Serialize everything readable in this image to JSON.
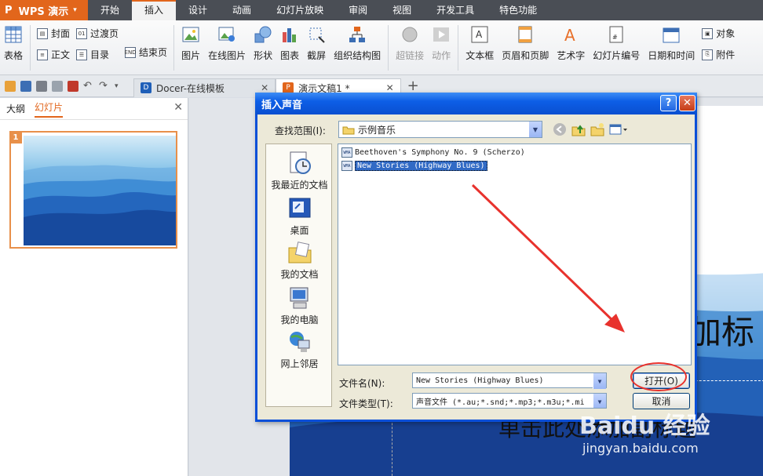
{
  "app": {
    "logo": "WPS 演示"
  },
  "menu": [
    "开始",
    "插入",
    "设计",
    "动画",
    "幻灯片放映",
    "审阅",
    "视图",
    "开发工具",
    "特色功能"
  ],
  "ribbon": {
    "table": "表格",
    "cover": "封面",
    "transition_page": "过渡页",
    "body": "正文",
    "toc": "目录",
    "end_page": "结束页",
    "picture": "图片",
    "online_picture": "在线图片",
    "shape": "形状",
    "chart": "图表",
    "screenshot": "截屏",
    "org_chart": "组织结构图",
    "hyperlink": "超链接",
    "action": "动作",
    "textbox": "文本框",
    "header_footer": "页眉和页脚",
    "wordart": "艺术字",
    "slide_number": "幻灯片编号",
    "datetime": "日期和时间",
    "object": "对象",
    "attachment": "附件"
  },
  "tabs": {
    "docer": "Docer-在线模板",
    "doc1": "演示文稿1 *"
  },
  "left_panel": {
    "outline": "大纲",
    "slides": "幻灯片",
    "slide_number": "1"
  },
  "slide": {
    "title_partial": "加标",
    "subtitle_partial": "单击此处添加副标题"
  },
  "dialog": {
    "title": "插入声音",
    "help": "?",
    "lookin_label": "查找范围(I):",
    "lookin_value": "示例音乐",
    "places": [
      "我最近的文档",
      "桌面",
      "我的文档",
      "我的电脑",
      "网上邻居"
    ],
    "files": [
      {
        "name": "Beethoven's Symphony No. 9 (Scherzo)",
        "selected": false
      },
      {
        "name": "New Stories (Highway Blues)",
        "selected": true
      }
    ],
    "filename_label": "文件名(N):",
    "filename_value": "New Stories (Highway Blues)",
    "filetype_label": "文件类型(T):",
    "filetype_value": "声音文件 (*.au;*.snd;*.mp3;*.m3u;*.mi",
    "open": "打开(O)",
    "cancel": "取消"
  },
  "watermark": {
    "brand": "Baidu 经验",
    "url": "jingyan.baidu.com"
  },
  "colors": {
    "accent": "#e2661c",
    "xp_blue": "#0a4fd8",
    "annotation_red": "#e8322d"
  }
}
